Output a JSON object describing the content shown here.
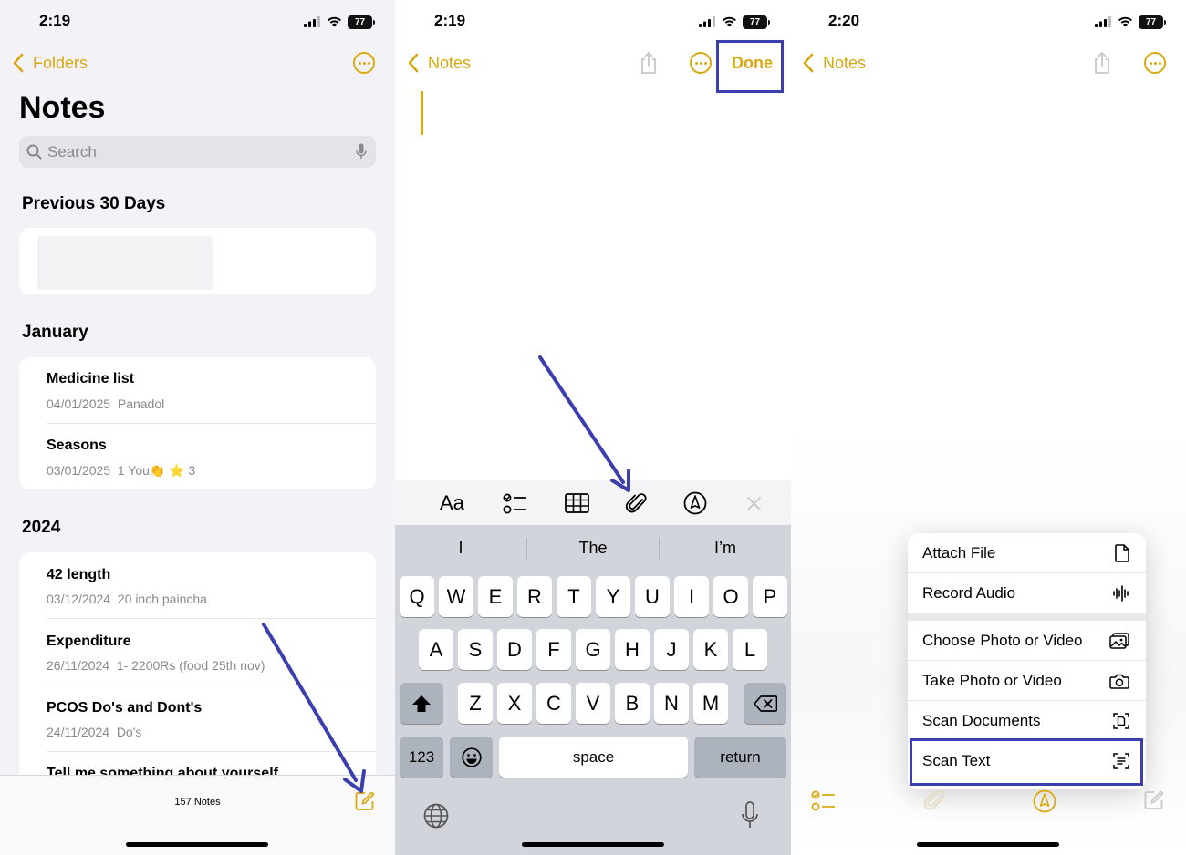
{
  "screen1": {
    "status": {
      "time": "2:19",
      "battery": "77"
    },
    "nav": {
      "back_label": "Folders"
    },
    "title": "Notes",
    "search": {
      "placeholder": "Search"
    },
    "sections": [
      {
        "header": "Previous 30 Days"
      },
      {
        "header": "January",
        "notes": [
          {
            "title": "Medicine list",
            "date": "04/01/2025",
            "preview": "Panadol"
          },
          {
            "title": "Seasons",
            "date": "03/01/2025",
            "preview": "1 You👏 ⭐ 3"
          }
        ]
      },
      {
        "header": "2024",
        "notes": [
          {
            "title": "42 length",
            "date": "03/12/2024",
            "preview": "20 inch paincha"
          },
          {
            "title": "Expenditure",
            "date": "26/11/2024",
            "preview": "1- 2200Rs (food 25th nov)"
          },
          {
            "title": "PCOS Do's and Dont's",
            "date": "24/11/2024",
            "preview": "Do's"
          },
          {
            "title": "Tell me something about yourself",
            "date": "",
            "preview": ""
          }
        ]
      }
    ],
    "footer": {
      "count": "157 Notes"
    }
  },
  "screen2": {
    "status": {
      "time": "2:19",
      "battery": "77"
    },
    "nav": {
      "back_label": "Notes",
      "done_label": "Done"
    },
    "toolbar": {
      "format_label": "Aa"
    },
    "suggestions": [
      "I",
      "The",
      "I’m"
    ],
    "keyboard": {
      "row1": [
        "Q",
        "W",
        "E",
        "R",
        "T",
        "Y",
        "U",
        "I",
        "O",
        "P"
      ],
      "row2": [
        "A",
        "S",
        "D",
        "F",
        "G",
        "H",
        "J",
        "K",
        "L"
      ],
      "row3": [
        "Z",
        "X",
        "C",
        "V",
        "B",
        "N",
        "M"
      ],
      "numbers_label": "123",
      "space_label": "space",
      "return_label": "return"
    }
  },
  "screen3": {
    "status": {
      "time": "2:20",
      "battery": "77"
    },
    "nav": {
      "back_label": "Notes"
    },
    "menu": {
      "group1": [
        {
          "label": "Attach File",
          "icon": "document-icon"
        },
        {
          "label": "Record Audio",
          "icon": "waveform-icon"
        }
      ],
      "group2": [
        {
          "label": "Choose Photo or Video",
          "icon": "photo-icon"
        },
        {
          "label": "Take Photo or Video",
          "icon": "camera-icon"
        },
        {
          "label": "Scan Documents",
          "icon": "doc-scan-icon"
        },
        {
          "label": "Scan Text",
          "icon": "text-scan-icon"
        }
      ]
    }
  },
  "colors": {
    "accent": "#d9a80f",
    "highlight": "#3b3fae"
  }
}
